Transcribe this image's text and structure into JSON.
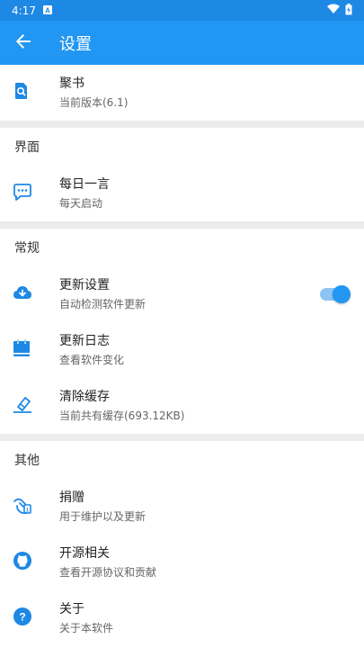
{
  "status_bar": {
    "time": "4:17",
    "notification_icon": "a-letter-icon",
    "wifi_icon": "wifi-icon",
    "battery_icon": "battery-charging-icon"
  },
  "app_bar": {
    "title": "设置",
    "back_icon": "arrow-back-icon"
  },
  "colors": {
    "primary": "#2196f3",
    "status_bar": "#1e88e5",
    "background": "#ececec"
  },
  "app_info": {
    "title": "聚书",
    "subtitle": "当前版本(6.1)",
    "icon": "book-search-icon"
  },
  "sections": [
    {
      "header": "界面",
      "items": [
        {
          "title": "每日一言",
          "subtitle": "每天启动",
          "icon": "chat-bubble-icon"
        }
      ]
    },
    {
      "header": "常规",
      "items": [
        {
          "title": "更新设置",
          "subtitle": "自动检测软件更新",
          "icon": "cloud-download-icon",
          "toggle_on": true
        },
        {
          "title": "更新日志",
          "subtitle": "查看软件变化",
          "icon": "calendar-icon"
        },
        {
          "title": "清除缓存",
          "subtitle": "当前共有缓存(693.12KB)",
          "icon": "eraser-icon"
        }
      ]
    },
    {
      "header": "其他",
      "items": [
        {
          "title": "捐赠",
          "subtitle": "用于维护以及更新",
          "icon": "donate-hand-icon"
        },
        {
          "title": "开源相关",
          "subtitle": "查看开源协议和贡献",
          "icon": "github-icon"
        },
        {
          "title": "关于",
          "subtitle": "关于本软件",
          "icon": "help-circle-icon"
        }
      ]
    }
  ]
}
